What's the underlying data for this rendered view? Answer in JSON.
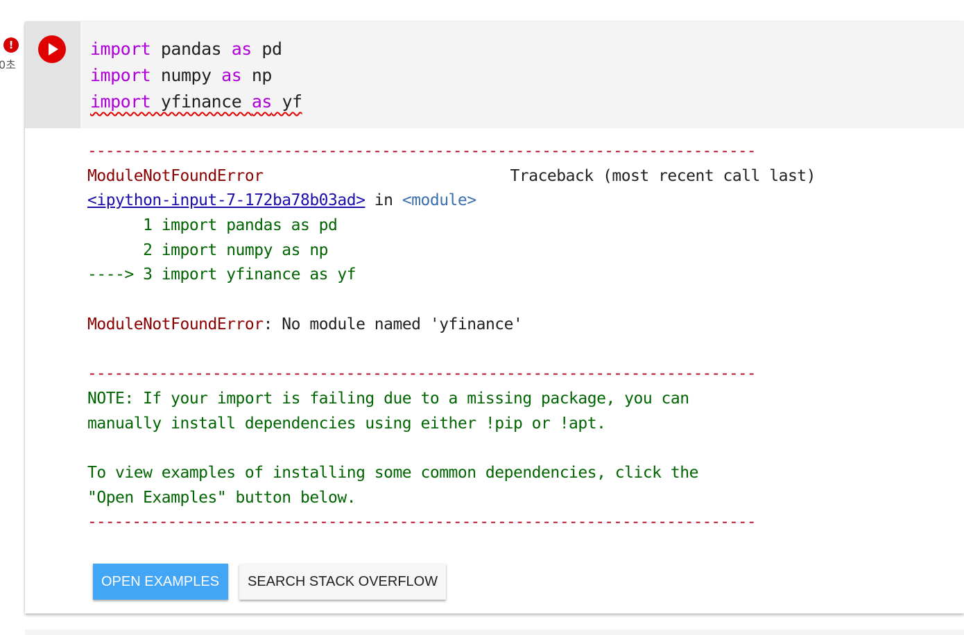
{
  "cell": {
    "status_icon": "error-icon",
    "status_symbol": "!",
    "exec_time": "0초",
    "run_icon": "play-icon",
    "colors": {
      "run_button": "#e00000",
      "keyword": "#af00db",
      "error_dot": "#d50000"
    },
    "code_lines": [
      {
        "kw1": "import",
        "mid": " pandas ",
        "kw2": "as",
        "end": " pd"
      },
      {
        "kw1": "import",
        "mid": " numpy ",
        "kw2": "as",
        "end": " np"
      },
      {
        "kw1": "import",
        "mid": " yfinance ",
        "kw2": "as",
        "end": " yf"
      }
    ]
  },
  "output": {
    "separator": "---------------------------------------------------------------------------",
    "error_name": "ModuleNotFoundError",
    "traceback_header": "Traceback (most recent call last)",
    "input_link": "<ipython-input-7-172ba78b03ad>",
    "in_word": " in ",
    "module_ref": "<module>",
    "trace_lines": [
      "      1 import pandas as pd",
      "      2 import numpy as np",
      "----> 3 import yfinance as yf"
    ],
    "error_message": ": No module named 'yfinance'",
    "note_lines": [
      "NOTE: If your import is failing due to a missing package, you can",
      "manually install dependencies using either !pip or !apt.",
      "",
      "To view examples of installing some common dependencies, click the",
      "\"Open Examples\" button below."
    ]
  },
  "buttons": {
    "open_examples": "OPEN EXAMPLES",
    "search_stack_overflow": "SEARCH STACK OVERFLOW"
  }
}
